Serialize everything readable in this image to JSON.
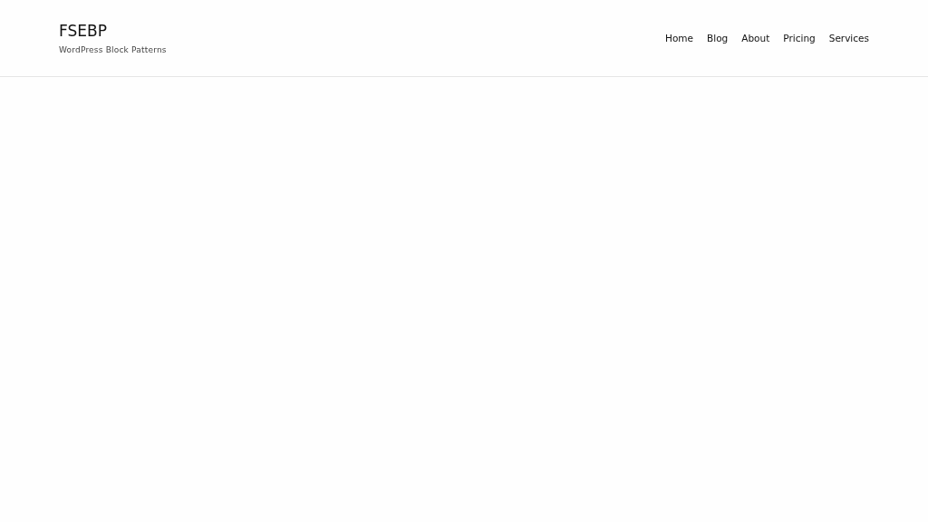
{
  "site": {
    "title": "FSEBP",
    "tagline": "WordPress Block Patterns"
  },
  "nav": [
    {
      "label": "Home"
    },
    {
      "label": "Blog"
    },
    {
      "label": "About"
    },
    {
      "label": "Pricing"
    },
    {
      "label": "Services"
    }
  ]
}
